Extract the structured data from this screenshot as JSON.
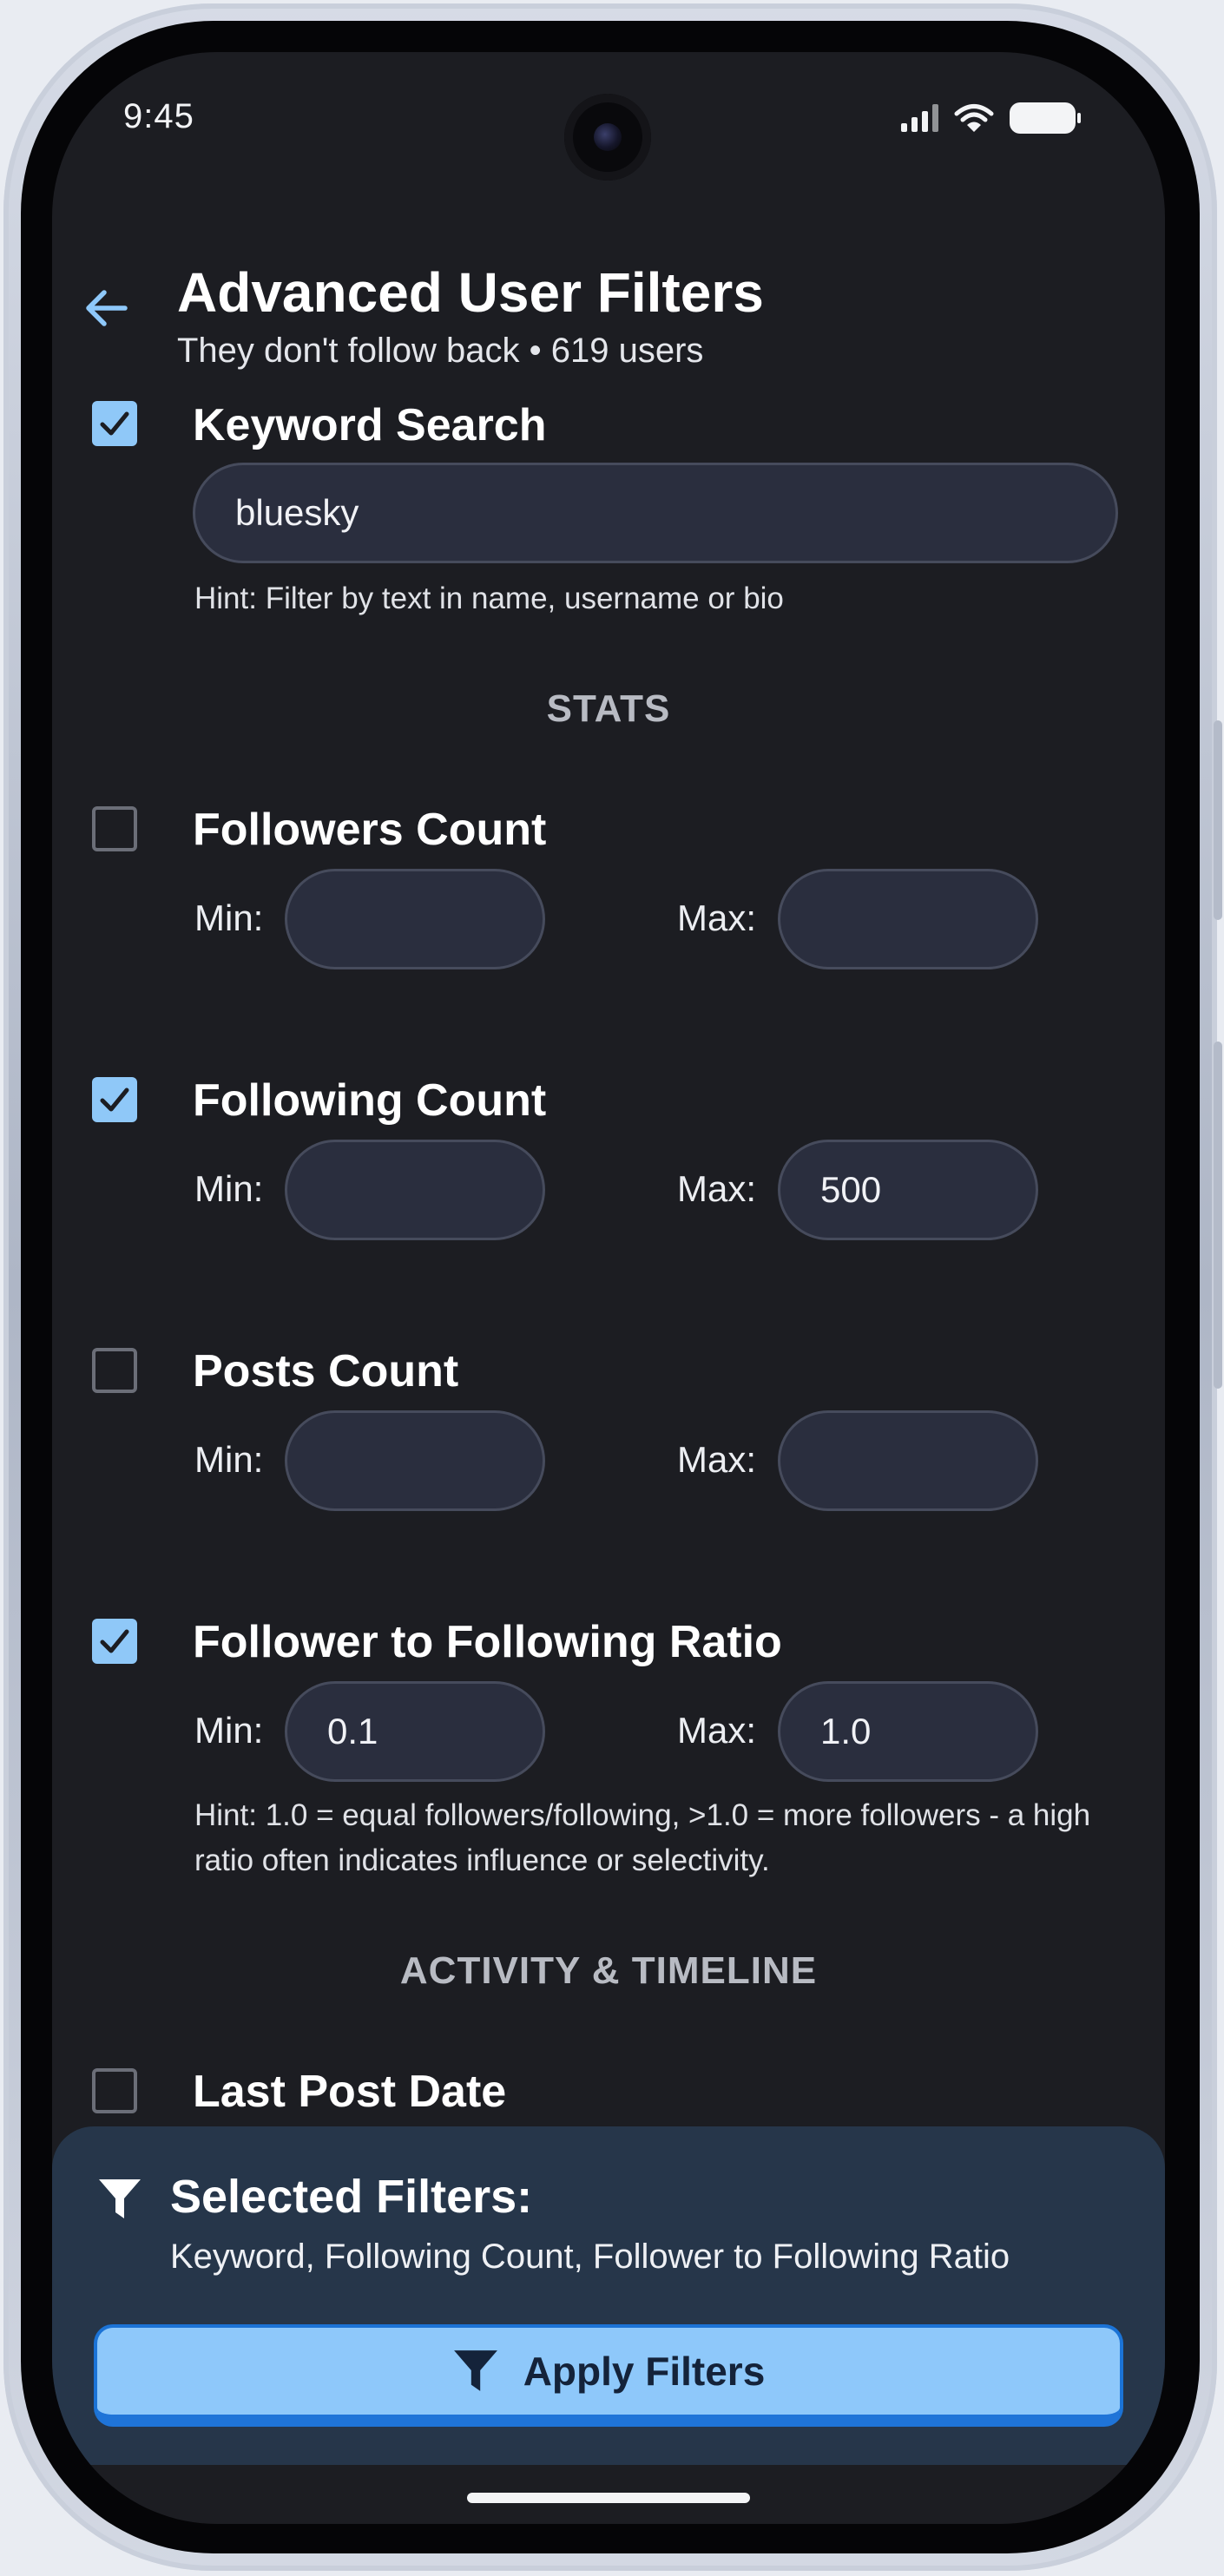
{
  "status_bar": {
    "time": "9:45",
    "icons": [
      "signal-icon",
      "wifi-icon",
      "battery-icon"
    ]
  },
  "header": {
    "back_icon": "arrow-left-icon",
    "title": "Advanced User Filters",
    "subtitle": "They don't follow back • 619 users"
  },
  "keyword": {
    "label": "Keyword Search",
    "checked": true,
    "value": "bluesky",
    "hint": "Hint: Filter by text in name, username or bio"
  },
  "sections": {
    "stats": "STATS",
    "activity": "ACTIVITY & TIMELINE"
  },
  "filters": {
    "followers": {
      "label": "Followers Count",
      "checked": false,
      "min_label": "Min:",
      "max_label": "Max:",
      "min": "",
      "max": ""
    },
    "following": {
      "label": "Following Count",
      "checked": true,
      "min_label": "Min:",
      "max_label": "Max:",
      "min": "",
      "max": "500"
    },
    "posts": {
      "label": "Posts Count",
      "checked": false,
      "min_label": "Min:",
      "max_label": "Max:",
      "min": "",
      "max": ""
    },
    "ratio": {
      "label": "Follower to Following Ratio",
      "checked": true,
      "min_label": "Min:",
      "max_label": "Max:",
      "min": "0.1",
      "max": "1.0",
      "hint": "Hint: 1.0 = equal followers/following, >1.0 = more followers  - a high ratio often indicates influence or selectivity."
    },
    "last_post": {
      "label": "Last Post Date",
      "checked": false
    }
  },
  "selected": {
    "icon": "filter-icon",
    "title": "Selected Filters:",
    "list": "Keyword, Following Count, Follower to Following Ratio"
  },
  "apply_button": {
    "label": "Apply Filters",
    "icon": "filter-icon"
  },
  "colors": {
    "accent": "#8ec8fa",
    "accent_border": "#1f74d8",
    "background": "#1c1d22",
    "input_bg": "#2a2e3e",
    "panel_bg": "#26364a"
  }
}
